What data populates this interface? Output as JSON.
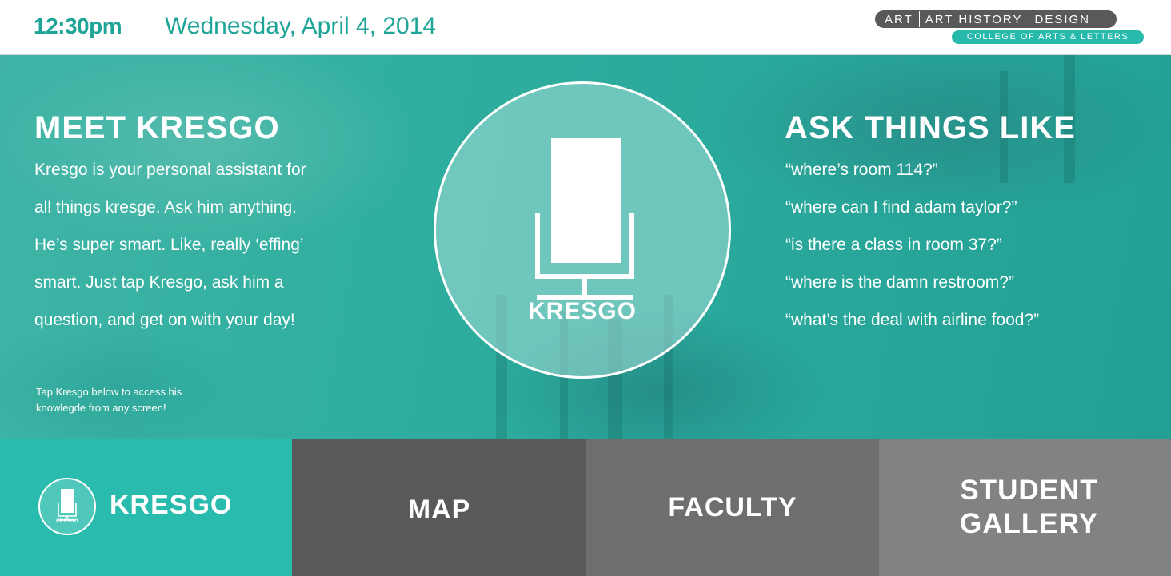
{
  "header": {
    "time": "12:30pm",
    "date": "Wednesday, April 4, 2014",
    "departments": [
      "ART",
      "ART HISTORY",
      "DESIGN"
    ],
    "college": "COLLEGE OF ARTS & LETTERS"
  },
  "hero": {
    "intro_heading": "MEET KRESGO",
    "intro_lines": [
      "Kresgo is your personal assistant for",
      "all things kresge. Ask him anything.",
      "He’s super smart. Like, really ‘effing’",
      "smart. Just tap Kresgo, ask him a",
      "question, and get on with your day!"
    ],
    "tip_lines": [
      "Tap Kresgo below to access his",
      "knowlegde from any screen!"
    ],
    "assistant_label": "KRESGO",
    "ask_heading": "ASK THINGS LIKE",
    "questions": [
      "“where’s room 114?”",
      "“where can I find adam taylor?”",
      "“is there a class in room 37?”",
      "“where is the damn restroom?”",
      "“what’s the deal with airline food?”"
    ]
  },
  "nav": {
    "kresgo_label": "KRESGO",
    "kresgo_icon_label": "KRESGO",
    "map_label": "MAP",
    "faculty_label": "FACULTY",
    "gallery_line1": "STUDENT",
    "gallery_line2": "GALLERY"
  },
  "colors": {
    "accent": "#29bbad",
    "time_text": "#1fa597",
    "nav_map": "#58595b",
    "nav_faculty": "#6d6e70",
    "nav_gallery": "#818284"
  },
  "icons": {
    "assistant": "microphone-icon"
  }
}
